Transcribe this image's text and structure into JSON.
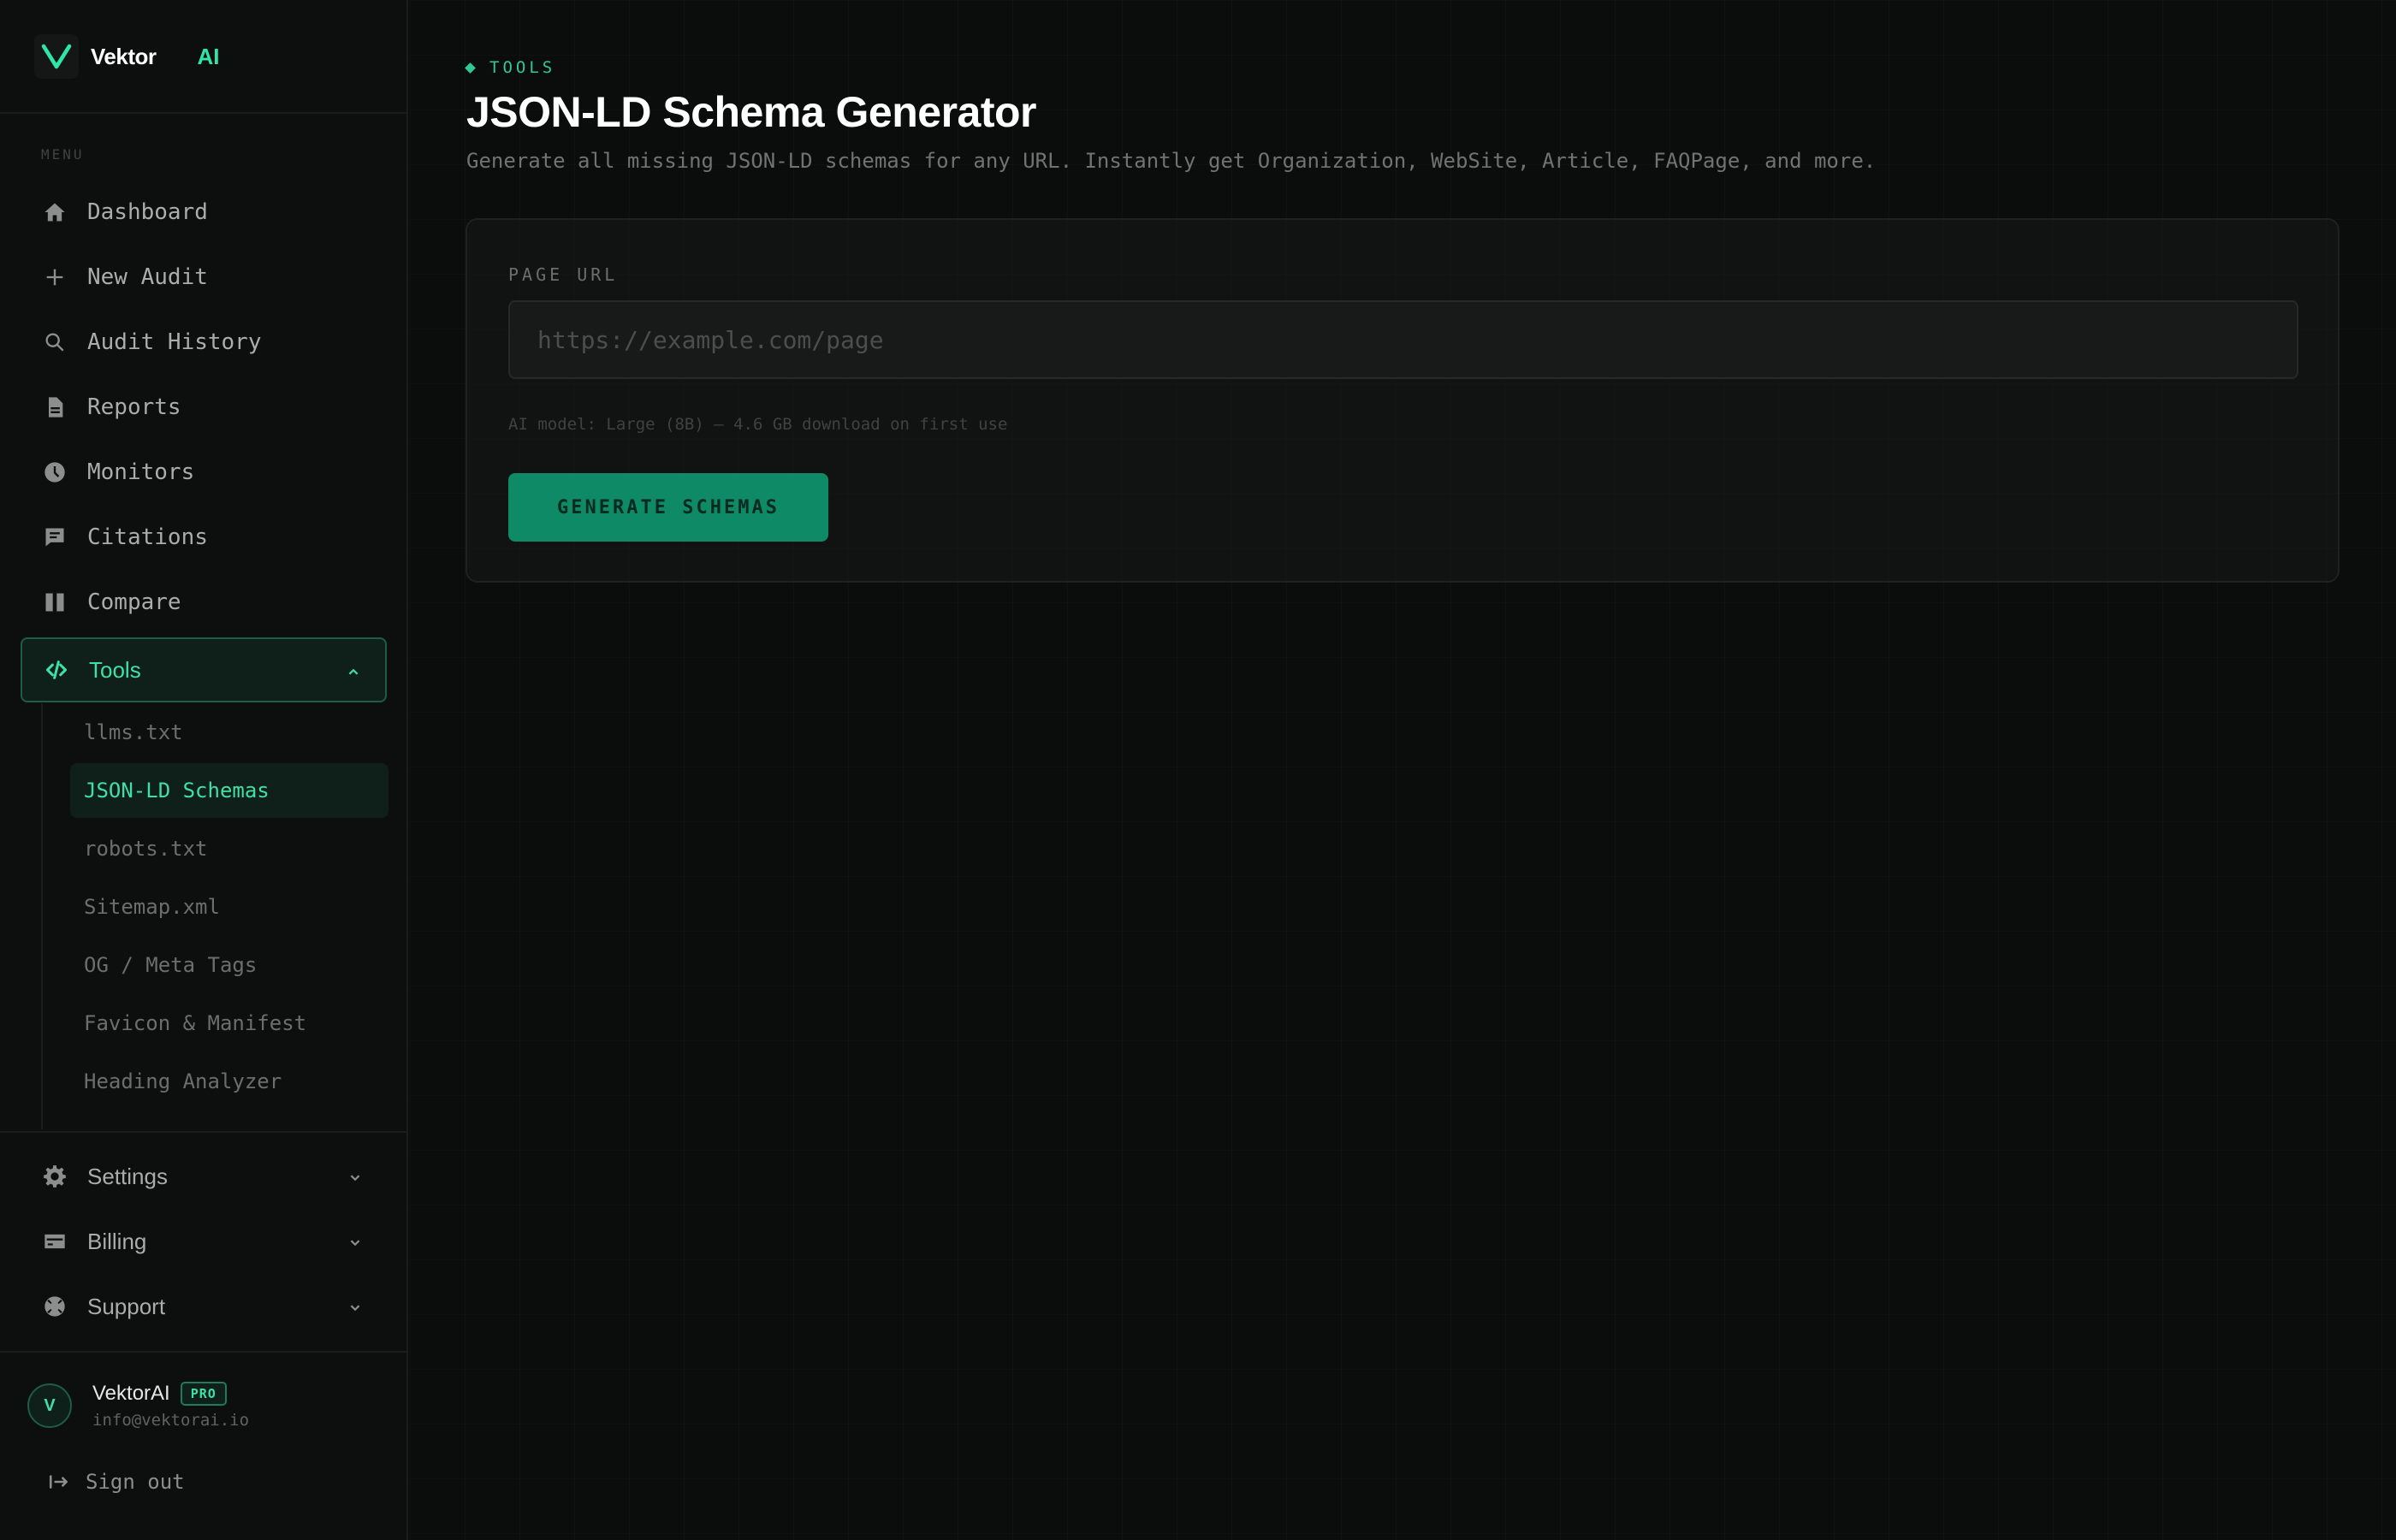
{
  "brand": {
    "name": "Vektor",
    "suffix": "AI",
    "accent": "#2ee6a8"
  },
  "sidebar": {
    "menu_label": "MENU",
    "items": [
      {
        "label": "Dashboard",
        "icon": "home-icon"
      },
      {
        "label": "New Audit",
        "icon": "plus-icon"
      },
      {
        "label": "Audit History",
        "icon": "search-icon"
      },
      {
        "label": "Reports",
        "icon": "document-icon"
      },
      {
        "label": "Monitors",
        "icon": "clock-icon"
      },
      {
        "label": "Citations",
        "icon": "chat-icon"
      },
      {
        "label": "Compare",
        "icon": "columns-icon"
      }
    ],
    "tools": {
      "label": "Tools",
      "icon": "code-icon",
      "expanded": true,
      "subitems": [
        {
          "label": "llms.txt"
        },
        {
          "label": "JSON-LD Schemas",
          "active": true
        },
        {
          "label": "robots.txt"
        },
        {
          "label": "Sitemap.xml"
        },
        {
          "label": "OG / Meta Tags"
        },
        {
          "label": "Favicon & Manifest"
        },
        {
          "label": "Heading Analyzer"
        }
      ]
    },
    "bottom_items": [
      {
        "label": "Settings",
        "icon": "gear-icon"
      },
      {
        "label": "Billing",
        "icon": "credit-card-icon"
      },
      {
        "label": "Support",
        "icon": "lifebuoy-icon"
      }
    ],
    "user": {
      "initial": "V",
      "name": "VektorAI",
      "badge": "PRO",
      "email": "info@vektorai.io"
    },
    "signout_label": "Sign out"
  },
  "main": {
    "breadcrumb": "TOOLS",
    "title": "JSON-LD Schema Generator",
    "subtitle": "Generate all missing JSON-LD schemas for any URL. Instantly get Organization, WebSite, Article, FAQPage, and more.",
    "form": {
      "field_label": "PAGE URL",
      "url_value": "",
      "url_placeholder": "https://example.com/page",
      "model_note": "AI model: Large (8B) — 4.6 GB download on first use",
      "submit_label": "GENERATE SCHEMAS"
    }
  }
}
